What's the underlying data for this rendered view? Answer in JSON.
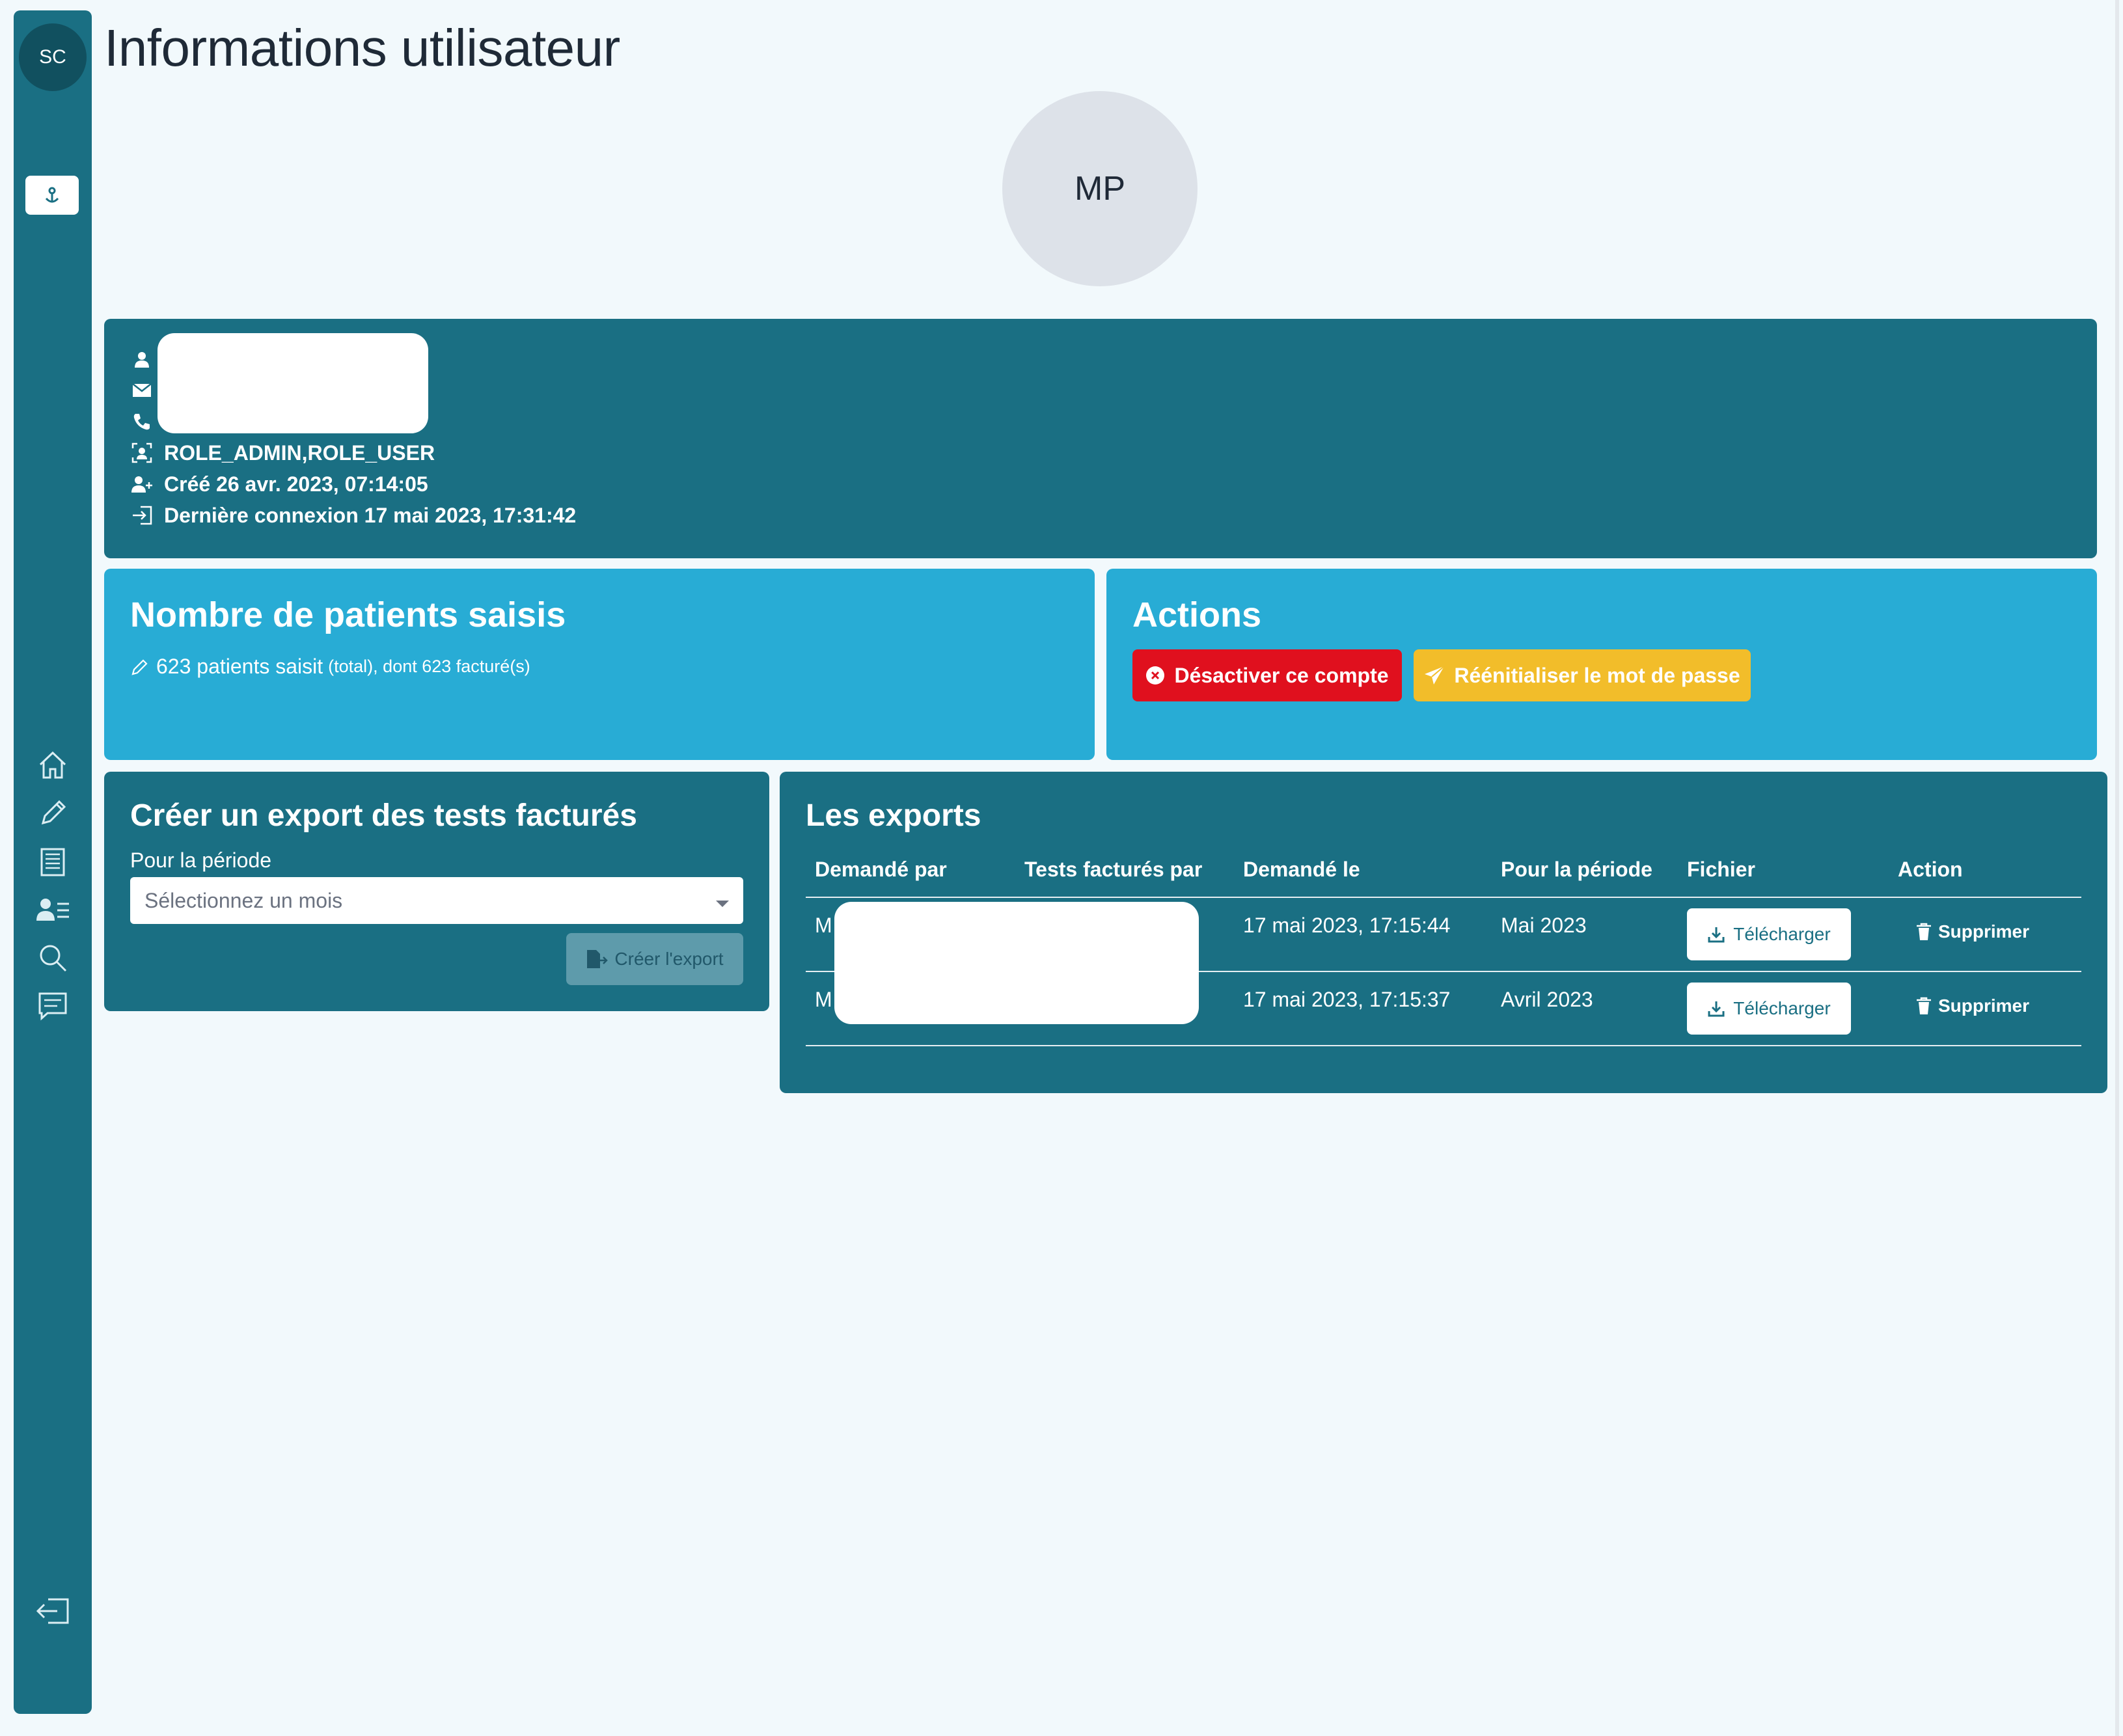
{
  "sidebar": {
    "user_initials": "SC",
    "active_icon": "anchor-pin-icon",
    "nav_items": [
      {
        "name": "home",
        "icon": "home-icon"
      },
      {
        "name": "edit",
        "icon": "pencil-icon"
      },
      {
        "name": "list",
        "icon": "list-document-icon"
      },
      {
        "name": "users",
        "icon": "user-list-icon"
      },
      {
        "name": "search",
        "icon": "search-icon"
      },
      {
        "name": "messages",
        "icon": "message-icon"
      }
    ],
    "logout_icon": "logout-icon"
  },
  "page": {
    "title": "Informations utilisateur"
  },
  "profile": {
    "initials": "MP"
  },
  "info": {
    "roles": "ROLE_ADMIN,ROLE_USER",
    "created": "Créé 26 avr. 2023, 07:14:05",
    "last_login": "Dernière connexion 17 mai 2023, 17:31:42"
  },
  "patients": {
    "title": "Nombre de patients saisis",
    "main_text": "623 patients saisit",
    "detail_text": "(total), dont 623 facturé(s)"
  },
  "actions": {
    "title": "Actions",
    "deactivate_label": "Désactiver ce compte",
    "reset_label": "Réénitialiser le mot de passe",
    "deactivate_color": "#e0101e",
    "reset_color": "#f2bd2a"
  },
  "create_export": {
    "title": "Créer un export des tests facturés",
    "period_label": "Pour la période",
    "select_placeholder": "Sélectionnez un mois",
    "create_label": "Créer l'export"
  },
  "exports": {
    "title": "Les exports",
    "columns": [
      "Demandé par",
      "Tests facturés par",
      "Demandé le",
      "Pour la période",
      "Fichier",
      "Action"
    ],
    "rows": [
      {
        "requested_by": "M",
        "requested_on": "17 mai 2023, 17:15:44",
        "period": "Mai 2023",
        "download_label": "Télécharger",
        "delete_label": "Supprimer"
      },
      {
        "requested_by": "M",
        "requested_on": "17 mai 2023, 17:15:37",
        "period": "Avril 2023",
        "download_label": "Télécharger",
        "delete_label": "Supprimer"
      }
    ]
  },
  "colors": {
    "sidebar": "#1a6f83",
    "card_dark": "#1a6f83",
    "card_light": "#28acd5",
    "background": "#f2f9fc"
  }
}
